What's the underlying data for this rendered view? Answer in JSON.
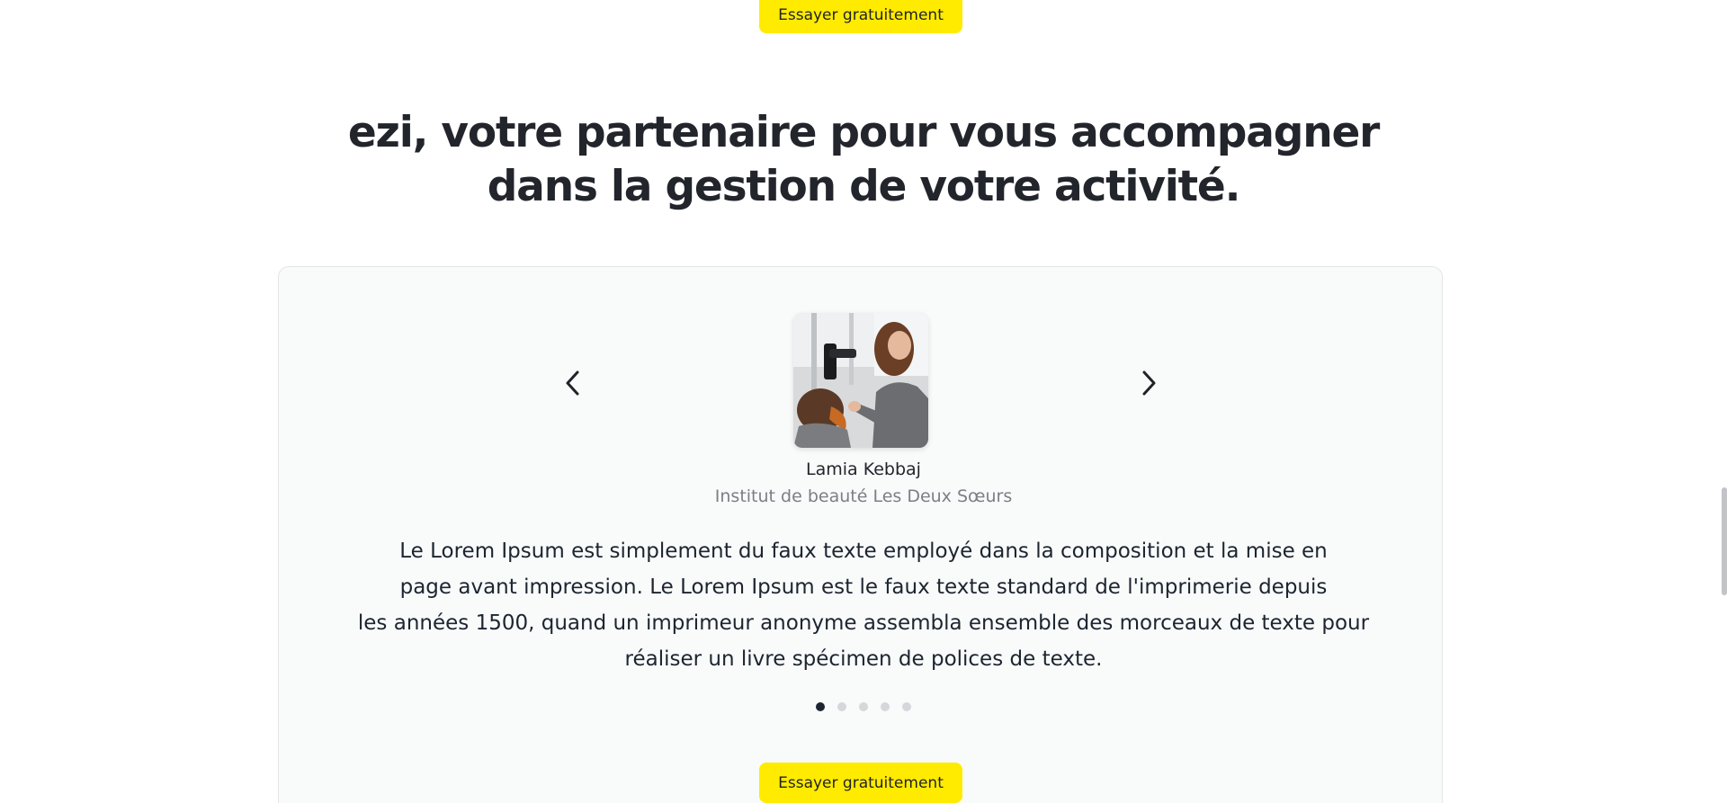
{
  "cta": {
    "top_label": "Essayer gratuitement",
    "bottom_label": "Essayer gratuitement"
  },
  "headline": {
    "line1": "ezi, votre partenaire pour vous accompagner",
    "line2": "dans la gestion de votre activité."
  },
  "testimonial": {
    "name": "Lamia Kebbaj",
    "company": "Institut de beauté Les Deux Sœurs",
    "quote_lines": [
      "Le Lorem Ipsum est simplement du faux texte employé dans la composition et la mise en",
      "page avant impression. Le Lorem Ipsum est le faux texte standard de l'imprimerie depuis",
      "les années 1500, quand un imprimeur anonyme assembla ensemble des morceaux de texte pour",
      "réaliser un livre spécimen de polices de texte."
    ],
    "photo_icon": "hairdresser-photo"
  },
  "carousel": {
    "prev_icon": "chevron-left-icon",
    "next_icon": "chevron-right-icon",
    "total_slides": 5,
    "active_slide": 1
  },
  "colors": {
    "accent_yellow": "#ffeb00",
    "text_dark": "#22252b",
    "text_muted": "#7b7f86",
    "card_bg": "#f9fafa",
    "dot_active": "#1c2530",
    "dot_inactive": "#d5d7da"
  }
}
